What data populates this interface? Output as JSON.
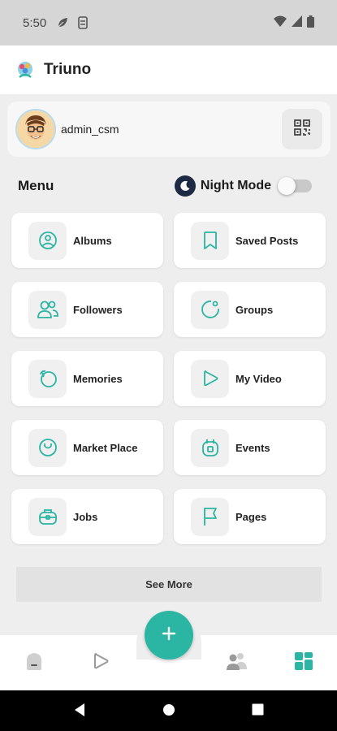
{
  "status_bar": {
    "time": "5:50"
  },
  "app": {
    "title": "Triuno"
  },
  "profile": {
    "username": "admin_csm"
  },
  "menu": {
    "title": "Menu",
    "night_mode_label": "Night Mode",
    "night_mode_on": false
  },
  "tiles": [
    {
      "label": "Albums",
      "icon": "album-icon"
    },
    {
      "label": "Saved Posts",
      "icon": "bookmark-icon"
    },
    {
      "label": "Followers",
      "icon": "followers-icon"
    },
    {
      "label": "Groups",
      "icon": "groups-icon"
    },
    {
      "label": "Memories",
      "icon": "memories-icon"
    },
    {
      "label": "My Video",
      "icon": "play-icon"
    },
    {
      "label": "Market Place",
      "icon": "shopping-bag-icon"
    },
    {
      "label": "Events",
      "icon": "calendar-icon"
    },
    {
      "label": "Jobs",
      "icon": "briefcase-icon"
    },
    {
      "label": "Pages",
      "icon": "flag-icon"
    }
  ],
  "see_more": {
    "label": "See More"
  },
  "colors": {
    "accent": "#2bb5a3",
    "night_badge": "#1d2a44",
    "background": "#efeeee"
  }
}
